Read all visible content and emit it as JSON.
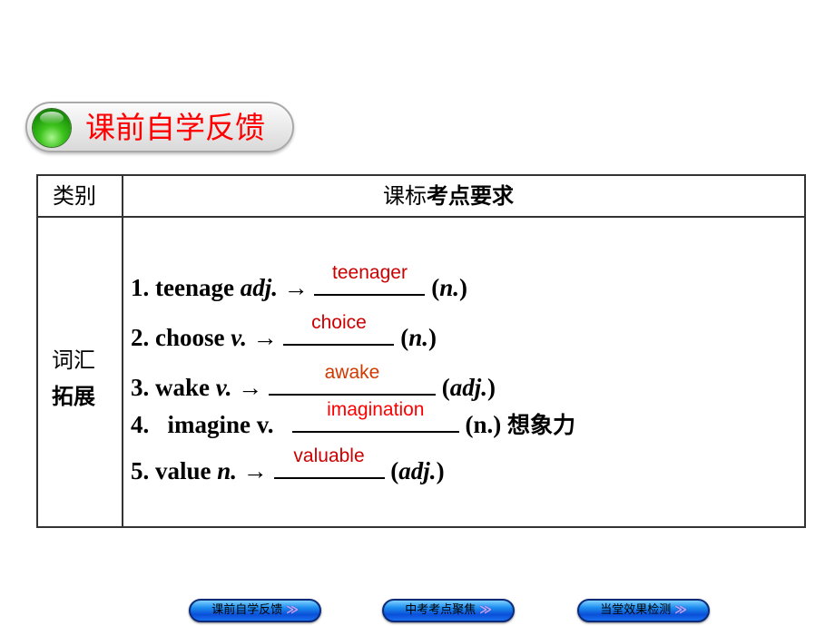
{
  "header": {
    "title": "课前自学反馈",
    "icon": "green-orb-icon"
  },
  "table": {
    "headers": {
      "category": "类别",
      "requirement_prefix": "课标",
      "requirement_bold": "考点要求"
    },
    "row_label_line1": "词汇",
    "row_label_line2": "拓展",
    "items": [
      {
        "prefix": "1. teenage ",
        "pos": "adj.",
        "arrow": " → ",
        "answer": "teenager",
        "suffix_open": " (",
        "suffix_pos": "n.",
        "suffix_close": ")"
      },
      {
        "prefix": "2. choose ",
        "pos": "v.",
        "arrow": " → ",
        "answer": "choice",
        "suffix_open": " (",
        "suffix_pos": "n.",
        "suffix_close": ")"
      },
      {
        "prefix": "3. wake ",
        "pos": "v.",
        "arrow": " → ",
        "answer": "awake",
        "suffix_open": " (",
        "suffix_pos": "adj.",
        "suffix_close": ")"
      },
      {
        "prefix": "4.   imagine v.   ",
        "answer": "imagination",
        "suffix": " (n.) ",
        "chinese": "想象力"
      },
      {
        "prefix": "5. value ",
        "pos": "n.",
        "arrow": " → ",
        "answer": "valuable",
        "suffix_open": " (",
        "suffix_pos": "adj.",
        "suffix_close": ")"
      }
    ]
  },
  "nav": {
    "buttons": [
      {
        "label": "课前自学反馈",
        "arrow": "≫"
      },
      {
        "label": "中考考点聚焦",
        "arrow": "≫"
      },
      {
        "label": "当堂效果检测",
        "arrow": "≫"
      }
    ]
  },
  "colors": {
    "header_title": "#ff0000",
    "answer_dark_red": "#cc0000",
    "answer_orange": "#d03a00",
    "answer_red": "#ff0000",
    "nav_blue": "#1e8ff0"
  }
}
